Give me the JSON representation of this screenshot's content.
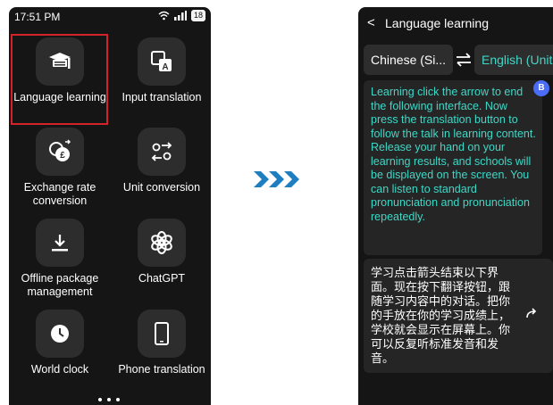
{
  "left_phone": {
    "status": {
      "time": "17:51 PM",
      "battery": "18"
    },
    "apps": [
      {
        "label": "Language learning",
        "icon": "graduation-cap-icon"
      },
      {
        "label": "Input translation",
        "icon": "translate-icon"
      },
      {
        "label": "Exchange rate conversion",
        "icon": "currency-exchange-icon"
      },
      {
        "label": "Unit conversion",
        "icon": "unit-conversion-icon"
      },
      {
        "label": "Offline package management",
        "icon": "download-icon"
      },
      {
        "label": "ChatGPT",
        "icon": "chatgpt-icon"
      },
      {
        "label": "World clock",
        "icon": "clock-icon"
      },
      {
        "label": "Phone translation",
        "icon": "phone-icon"
      }
    ],
    "highlight_color": "#d2232a"
  },
  "arrows": {
    "icon": "triple-chevron-right-icon",
    "color": "#1e7fc0"
  },
  "right_phone": {
    "title": "Language learning",
    "source_lang": "Chinese (Si...",
    "target_lang": "English (Unit...",
    "badge": "B",
    "english_text": "Learning click the arrow to end the following interface. Now press the translation button to follow the talk in learning content. Release your hand on your learning results, and schools will be displayed on the screen. You can listen to standard pronunciation and pronunciation repeatedly.",
    "chinese_text": "学习点击箭头结束以下界面。现在按下翻译按钮，跟随学习内容中的对话。把你的手放在你的学习成绩上，学校就会显示在屏幕上。你可以反复听标准发音和发音。",
    "accent_color": "#3fd8c7"
  }
}
